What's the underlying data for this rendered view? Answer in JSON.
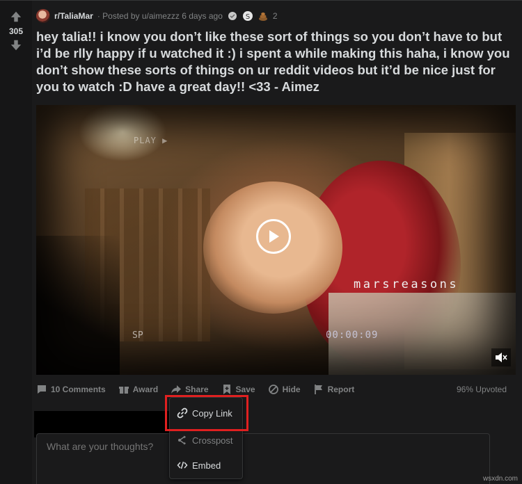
{
  "post": {
    "score": "305",
    "subreddit": "r/TaliaMar",
    "meta_text": "· Posted by u/aimezzz 6 days ago",
    "award_count": "2",
    "title": "hey talia!! i know you don’t like these sort of things so you don’t have to but i’d be rlly happy if u watched it :) i spent a while making this haha, i know you don’t show these sorts of things on ur reddit videos but it’d be nice just for you to watch :D have a great day!! <33 - Aimez"
  },
  "video": {
    "overlay_play": "PLAY ▶",
    "watermark": "marsreasons",
    "sp_label": "SP",
    "timecode": "00:00:09"
  },
  "actions": {
    "comments": "10 Comments",
    "award": "Award",
    "share": "Share",
    "save": "Save",
    "hide": "Hide",
    "report": "Report",
    "upvoted": "96% Upvoted"
  },
  "share_menu": {
    "copy_link": "Copy Link",
    "crosspost": "Crosspost",
    "embed": "Embed"
  },
  "comment": {
    "placeholder": "What are your thoughts?"
  },
  "site_watermark": "wsxdn.com",
  "colors": {
    "background": "#1a1a1b",
    "text": "#d7dadc",
    "muted": "#818384",
    "highlight_box": "#e02020"
  }
}
